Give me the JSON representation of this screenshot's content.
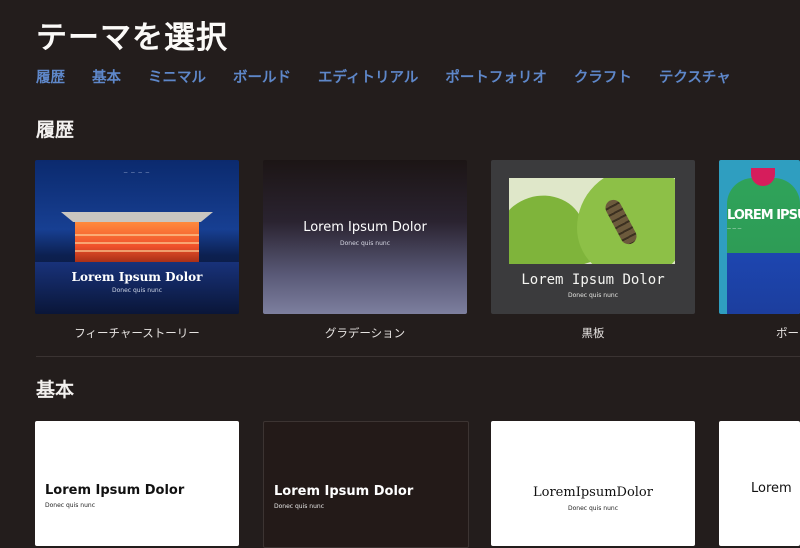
{
  "header": {
    "title": "テーマを選択"
  },
  "tabs": [
    {
      "label": "履歴"
    },
    {
      "label": "基本"
    },
    {
      "label": "ミニマル"
    },
    {
      "label": "ボールド"
    },
    {
      "label": "エディトリアル"
    },
    {
      "label": "ポートフォリオ"
    },
    {
      "label": "クラフト"
    },
    {
      "label": "テクスチャ"
    }
  ],
  "colors": {
    "background": "#231d1c",
    "tab_accent": "#5e87c9"
  },
  "recent": {
    "title": "履歴",
    "themes": [
      {
        "name": "フィーチャーストーリー",
        "thumb_title": "Lorem Ipsum Dolor",
        "thumb_sub": "Donec quis nunc"
      },
      {
        "name": "グラデーション",
        "thumb_title": "Lorem Ipsum Dolor",
        "thumb_sub": "Donec quis nunc"
      },
      {
        "name": "黒板",
        "thumb_title": "Lorem Ipsum Dolor",
        "thumb_sub": "Donec quis nunc"
      },
      {
        "name": "ポー",
        "thumb_title": "LOREM IPSU"
      }
    ]
  },
  "basic": {
    "title": "基本",
    "themes": [
      {
        "thumb_title": "Lorem Ipsum Dolor",
        "thumb_sub": "Donec quis nunc"
      },
      {
        "thumb_title": "Lorem Ipsum Dolor",
        "thumb_sub": "Donec quis nunc"
      },
      {
        "thumb_title": "LoremIpsumDolor",
        "thumb_sub": "Donec quis nunc"
      },
      {
        "thumb_title": "Lorem"
      }
    ]
  }
}
